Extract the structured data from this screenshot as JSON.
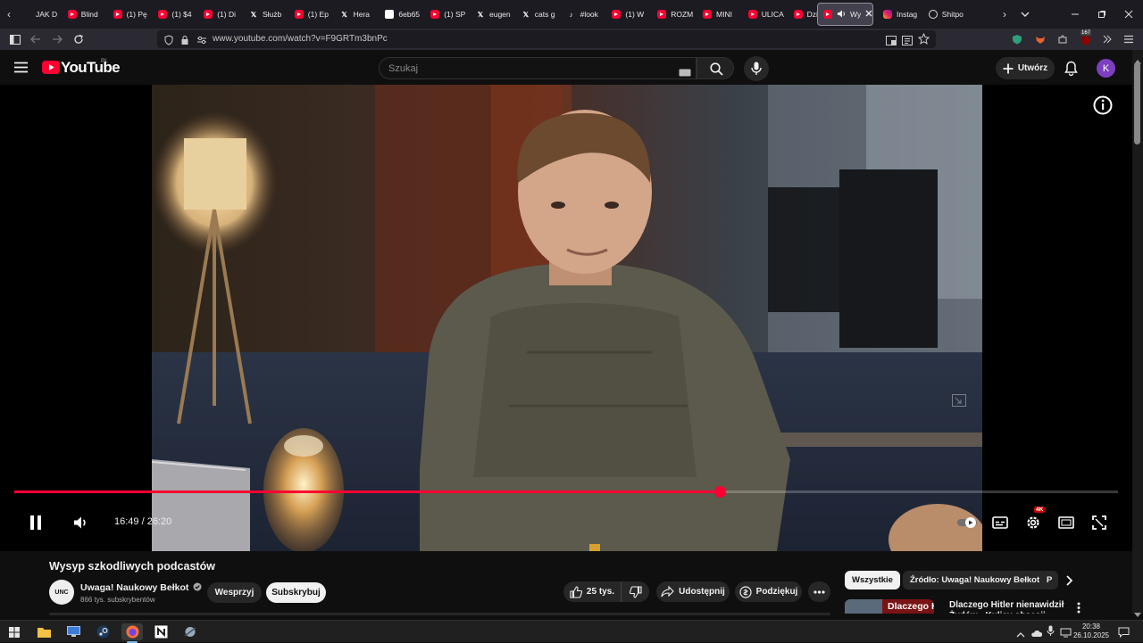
{
  "browser": {
    "tabs": [
      {
        "label": "JAK D",
        "favicon": "generic"
      },
      {
        "label": "Blind",
        "favicon": "youtube"
      },
      {
        "label": "(1) Pę",
        "favicon": "youtube"
      },
      {
        "label": "(1) $4",
        "favicon": "youtube"
      },
      {
        "label": "(1) Di",
        "favicon": "youtube"
      },
      {
        "label": "Służb",
        "favicon": "x"
      },
      {
        "label": "(1) Ep",
        "favicon": "youtube"
      },
      {
        "label": "Hera",
        "favicon": "x"
      },
      {
        "label": "6eb65",
        "favicon": "white"
      },
      {
        "label": "(1) SP",
        "favicon": "youtube"
      },
      {
        "label": "eugen",
        "favicon": "x"
      },
      {
        "label": "cats g",
        "favicon": "x"
      },
      {
        "label": "#look",
        "favicon": "tiktok"
      },
      {
        "label": "(1) W",
        "favicon": "youtube"
      },
      {
        "label": "ROZM",
        "favicon": "youtube"
      },
      {
        "label": "MINI",
        "favicon": "youtube"
      },
      {
        "label": "ULICA",
        "favicon": "youtube"
      },
      {
        "label": "Dzicy",
        "favicon": "youtube"
      },
      {
        "label": "Wy",
        "favicon": "youtube",
        "active": true
      },
      {
        "label": "Instag",
        "favicon": "instagram"
      },
      {
        "label": "Shitpo",
        "favicon": "circle"
      }
    ],
    "url": "www.youtube.com/watch?v=F9GRTm3bnPc",
    "extension_badge": "167"
  },
  "youtube": {
    "logo": "YouTube",
    "region": "PL",
    "search_placeholder": "Szukaj",
    "create_label": "Utwórz",
    "avatar_letter": "K"
  },
  "player": {
    "time_display": "16:49 / 26:20",
    "progress": 0.639,
    "quality_badge": "4K"
  },
  "video": {
    "title": "Wysyp szkodliwych podcastów",
    "channel_logo_text": "UNC",
    "channel_name": "Uwaga! Naukowy Bełkot",
    "subscribers": "866 tys. subskrybentów",
    "support_label": "Wesprzyj",
    "subscribe_label": "Subskrybuj",
    "likes": "25 tys.",
    "share_label": "Udostępnij",
    "thanks_label": "Podziękuj"
  },
  "sidebar": {
    "chips": [
      "Wszystkie",
      "Źródło: Uwaga! Naukowy Bełkot",
      "P"
    ],
    "next_thumb_text": "Dlaczego Hitler",
    "next_title": "Dlaczego Hitler nienawidził Żydów - Kulisy obsesji"
  },
  "taskbar": {
    "time": "20:38",
    "date": "26.10.2025"
  },
  "colors": {
    "accent": "#ff0033",
    "background": "#0f0f0f"
  }
}
